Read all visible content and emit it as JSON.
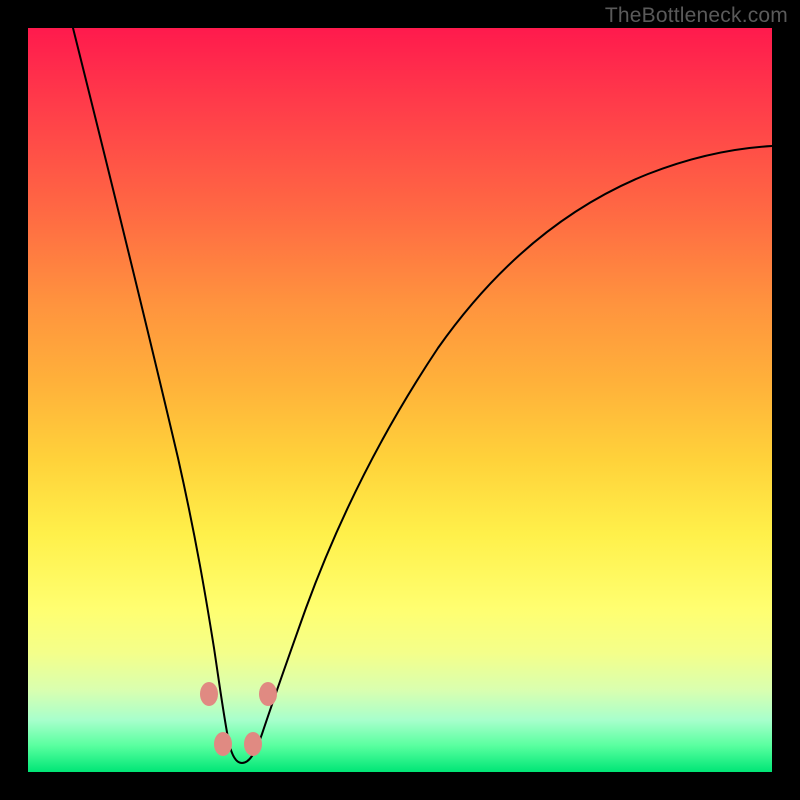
{
  "watermark": "TheBottleneck.com",
  "colors": {
    "frame": "#000000",
    "curve": "#000000",
    "nub": "#e08a82",
    "gradient_top": "#ff1a4d",
    "gradient_bottom": "#00e676"
  },
  "chart_data": {
    "type": "line",
    "title": "",
    "xlabel": "",
    "ylabel": "",
    "xlim": [
      0,
      1
    ],
    "ylim": [
      0,
      1
    ],
    "note": "Axes are normalized (no tick labels shown). y=1 at top, y≈0 at bottom. Single V-shaped bottleneck curve with minimum near x≈0.28, y≈0.02; right branch asymptotes toward y≈0.82 at x=1.",
    "series": [
      {
        "name": "bottleneck-curve",
        "x": [
          0.06,
          0.11,
          0.16,
          0.2,
          0.23,
          0.25,
          0.265,
          0.28,
          0.3,
          0.32,
          0.35,
          0.4,
          0.47,
          0.56,
          0.66,
          0.78,
          0.9,
          1.0
        ],
        "y": [
          1.0,
          0.77,
          0.53,
          0.34,
          0.2,
          0.11,
          0.055,
          0.02,
          0.025,
          0.06,
          0.13,
          0.26,
          0.41,
          0.54,
          0.65,
          0.73,
          0.78,
          0.82
        ]
      }
    ],
    "markers": [
      {
        "name": "nub-left-upper",
        "x": 0.243,
        "y": 0.105
      },
      {
        "name": "nub-left-lower",
        "x": 0.262,
        "y": 0.037
      },
      {
        "name": "nub-right-lower",
        "x": 0.303,
        "y": 0.037
      },
      {
        "name": "nub-right-upper",
        "x": 0.323,
        "y": 0.105
      }
    ]
  }
}
